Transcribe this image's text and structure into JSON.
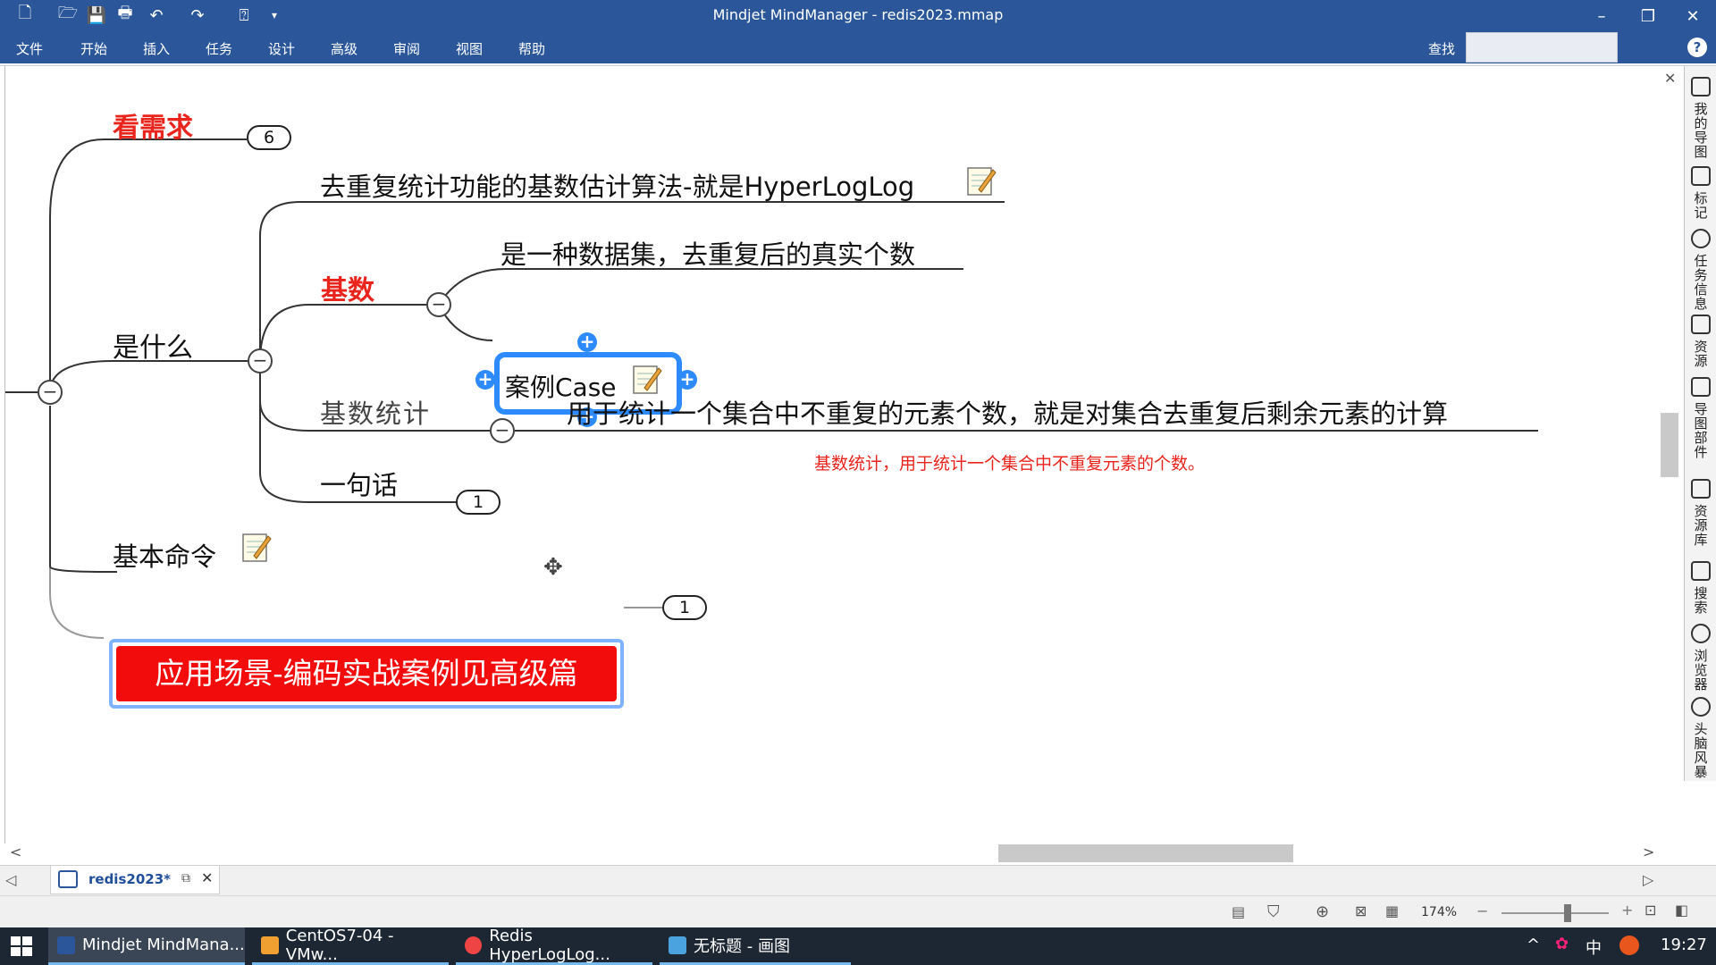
{
  "window": {
    "title": "Mindjet MindManager - redis2023.mmap"
  },
  "menu": {
    "items": [
      "文件",
      "开始",
      "插入",
      "任务",
      "设计",
      "高级",
      "审阅",
      "视图",
      "帮助"
    ],
    "search_label": "查找"
  },
  "map": {
    "branch_need": "看需求",
    "branch_need_count": "6",
    "branch_what": "是什么",
    "hll_line": "去重复统计功能的基数估计算法-就是HyperLogLog",
    "cardinality": "基数",
    "cardinality_def": "是一种数据集，去重复后的真实个数",
    "case_node": "案例Case",
    "card_stat": "基数统计",
    "card_stat_def": "用于统计一个集合中不重复的元素个数，就是对集合去重复后剩余元素的计算",
    "card_stat_note": "基数统计，用于统计一个集合中不重复元素的个数。",
    "one_sentence": "一句话",
    "one_sentence_count": "1",
    "basic_cmd": "基本命令",
    "scene": "应用场景-编码实战案例见高级篇",
    "scene_count": "1"
  },
  "side_panel": [
    "我的导图",
    "标记",
    "任务信息",
    "资源",
    "导图部件",
    "资源库",
    "搜索",
    "浏览器",
    "头脑风暴"
  ],
  "doc_tab": {
    "label": "redis2023*"
  },
  "status": {
    "zoom": "174%"
  },
  "taskbar": {
    "items": [
      "Mindjet MindMana...",
      "CentOS7-04 - VMw...",
      "Redis HyperLogLog...",
      "无标题 - 画图"
    ],
    "ime": "中",
    "clock": "19:27"
  },
  "colors": {
    "ribbon": "#2b579a",
    "red_text": "#e8241d",
    "scene_fill": "#f20c0c",
    "selection": "#2e8bff"
  }
}
